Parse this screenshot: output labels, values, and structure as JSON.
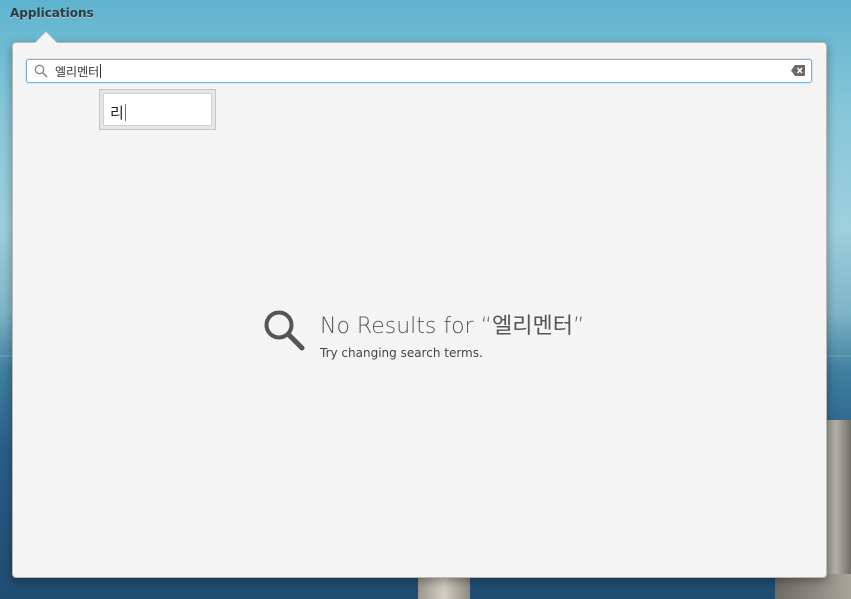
{
  "topbar": {
    "applications_label": "Applications"
  },
  "search": {
    "value": "엘리멘터",
    "icons": {
      "search": "search-icon",
      "clear": "backspace-clear-icon"
    }
  },
  "ime": {
    "composing_text": "리"
  },
  "empty_state": {
    "title": "No Results for “엘리멘터”",
    "subtitle": "Try changing search terms.",
    "icon": "search-icon"
  },
  "colors": {
    "popover_bg": "#f4f4f4",
    "search_focus_border": "#7fb2d9",
    "ime_caret": "#d9502f"
  }
}
